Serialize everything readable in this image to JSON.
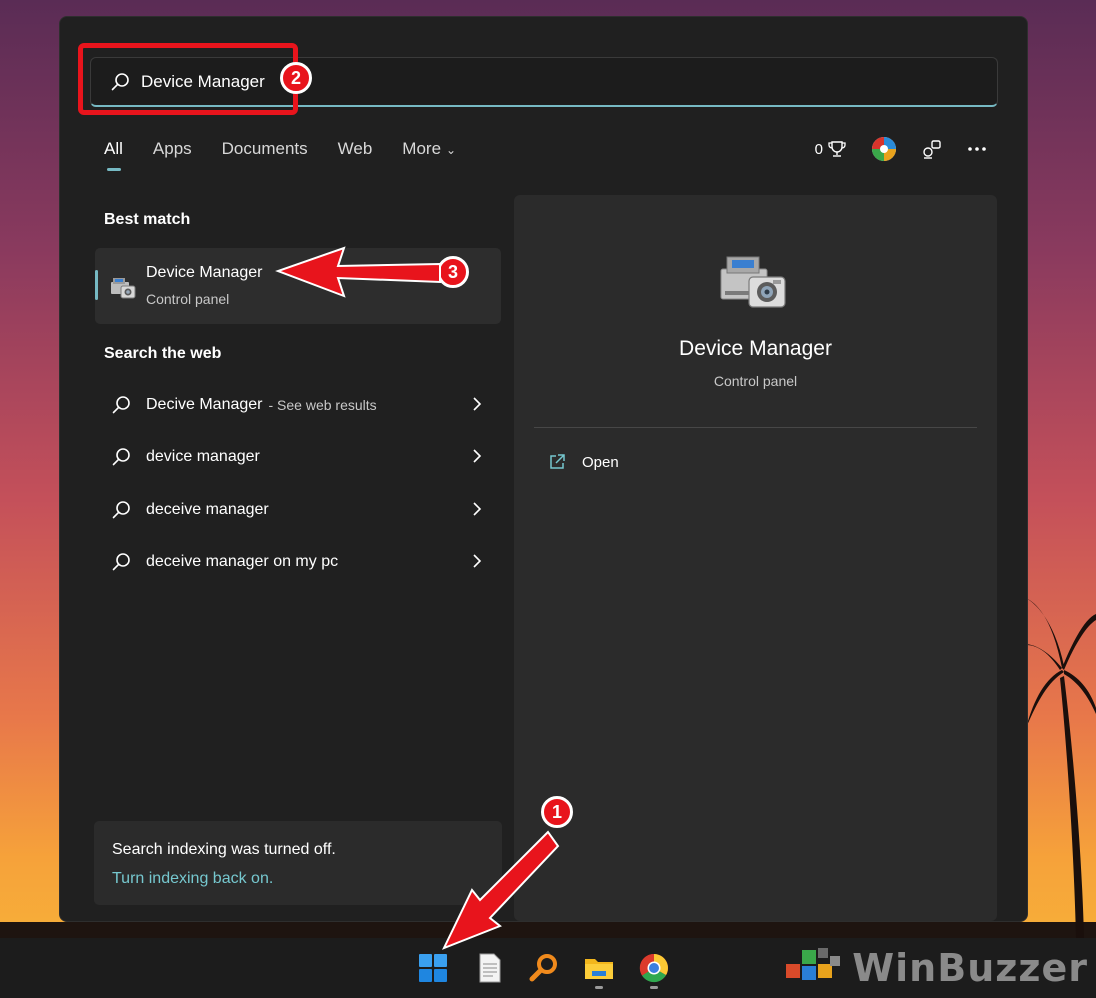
{
  "search": {
    "value": "Device Manager",
    "placeholder": ""
  },
  "tabs": [
    {
      "label": "All"
    },
    {
      "label": "Apps"
    },
    {
      "label": "Documents"
    },
    {
      "label": "Web"
    },
    {
      "label": "More"
    }
  ],
  "header": {
    "points": "0"
  },
  "best_match": {
    "section_title": "Best match",
    "title": "Device Manager",
    "subtitle": "Control panel"
  },
  "search_web": {
    "section_title": "Search the web",
    "items": [
      {
        "label": "Decive Manager",
        "sub": "- See web results"
      },
      {
        "label": "device manager",
        "sub": ""
      },
      {
        "label": "deceive manager",
        "sub": ""
      },
      {
        "label": "deceive manager on my pc",
        "sub": ""
      }
    ]
  },
  "indexing": {
    "message": "Search indexing was turned off.",
    "link": "Turn indexing back on."
  },
  "preview": {
    "title": "Device Manager",
    "subtitle": "Control panel",
    "open_label": "Open"
  },
  "annotations": {
    "badge_1": "1",
    "badge_2": "2",
    "badge_3": "3"
  },
  "watermark": {
    "text": "WinBuzzer"
  },
  "colors": {
    "accent": "#76b9c3",
    "annotation_red": "#e8141c",
    "panel_bg": "#202020",
    "link": "#76c8cf"
  },
  "icons": {
    "search": "search-icon",
    "more_options": "ellipsis-icon",
    "trophy": "trophy-icon",
    "avatar": "avatar-icon",
    "share": "share-icon",
    "chevron": "chevron-right-icon",
    "open": "open-external-icon",
    "device_manager": "device-manager-icon",
    "start": "windows-start-icon",
    "notepad": "notepad-icon",
    "search_app": "search-app-icon",
    "explorer": "file-explorer-icon",
    "chrome": "chrome-icon"
  }
}
